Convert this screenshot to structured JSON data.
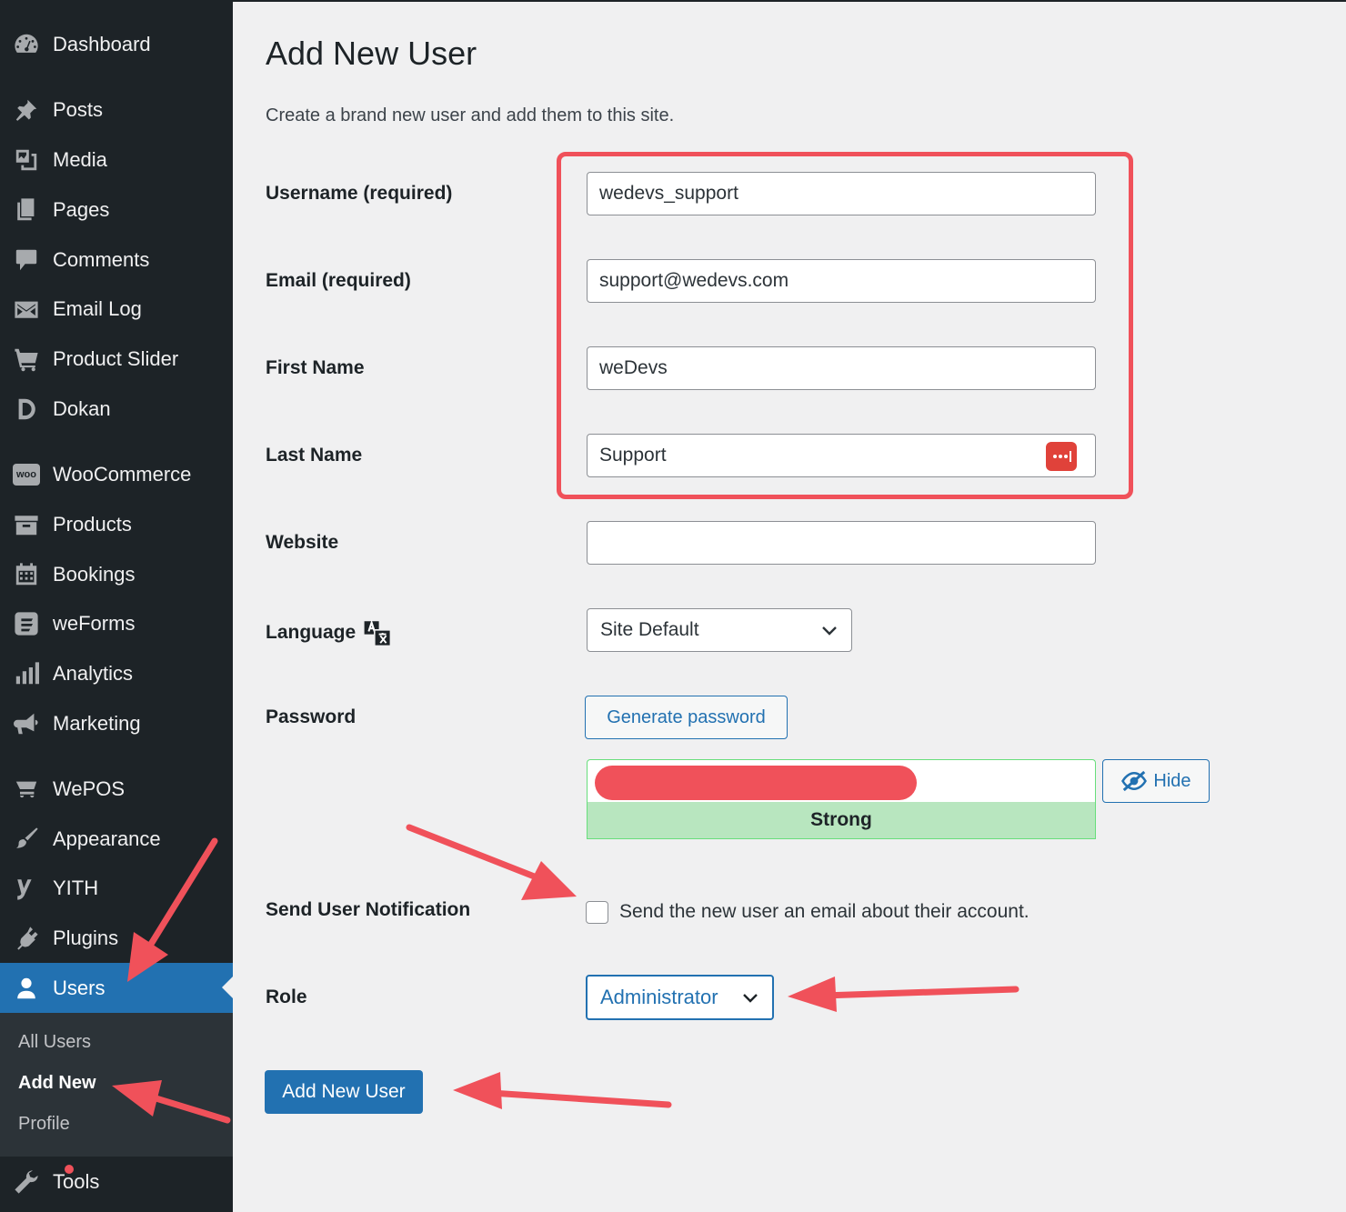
{
  "sidebar": {
    "items": [
      {
        "label": "Dashboard",
        "icon": "dashboard-icon"
      },
      {
        "label": "Posts",
        "icon": "pin-icon"
      },
      {
        "label": "Media",
        "icon": "media-icon"
      },
      {
        "label": "Pages",
        "icon": "pages-icon"
      },
      {
        "label": "Comments",
        "icon": "comment-icon"
      },
      {
        "label": "Email Log",
        "icon": "envelope-icon"
      },
      {
        "label": "Product Slider",
        "icon": "cart-icon"
      },
      {
        "label": "Dokan",
        "icon": "dokan-icon"
      },
      {
        "label": "WooCommerce",
        "icon": "woo-icon"
      },
      {
        "label": "Products",
        "icon": "archive-icon"
      },
      {
        "label": "Bookings",
        "icon": "calendar-icon"
      },
      {
        "label": "weForms",
        "icon": "weforms-icon"
      },
      {
        "label": "Analytics",
        "icon": "bar-chart-icon"
      },
      {
        "label": "Marketing",
        "icon": "megaphone-icon"
      },
      {
        "label": "WePOS",
        "icon": "pos-icon"
      },
      {
        "label": "Appearance",
        "icon": "paintbrush-icon"
      },
      {
        "label": "YITH",
        "icon": "yith-icon"
      },
      {
        "label": "Plugins",
        "icon": "plug-icon"
      },
      {
        "label": "Users",
        "icon": "user-icon"
      },
      {
        "label": "Tools",
        "icon": "wrench-icon"
      }
    ],
    "woo_badge": "woo",
    "submenu": [
      "All Users",
      "Add New",
      "Profile"
    ]
  },
  "page": {
    "title": "Add New User",
    "description": "Create a brand new user and add them to this site."
  },
  "form": {
    "username_label": "Username (required)",
    "username_value": "wedevs_support",
    "email_label": "Email (required)",
    "email_value": "support@wedevs.com",
    "first_name_label": "First Name",
    "first_name_value": "weDevs",
    "last_name_label": "Last Name",
    "last_name_value": "Support",
    "website_label": "Website",
    "website_value": "",
    "language_label": "Language",
    "language_value": "Site Default",
    "password_label": "Password",
    "generate_password_label": "Generate password",
    "hide_label": "Hide",
    "strength_label": "Strong",
    "notification_label": "Send User Notification",
    "notification_text": "Send the new user an email about their account.",
    "notification_checked": false,
    "role_label": "Role",
    "role_value": "Administrator",
    "submit_label": "Add New User"
  },
  "colors": {
    "sidebar_bg": "#1d2327",
    "accent": "#2271b1",
    "annotation": "#f0515a",
    "strength_bg": "#b8e6bf"
  }
}
